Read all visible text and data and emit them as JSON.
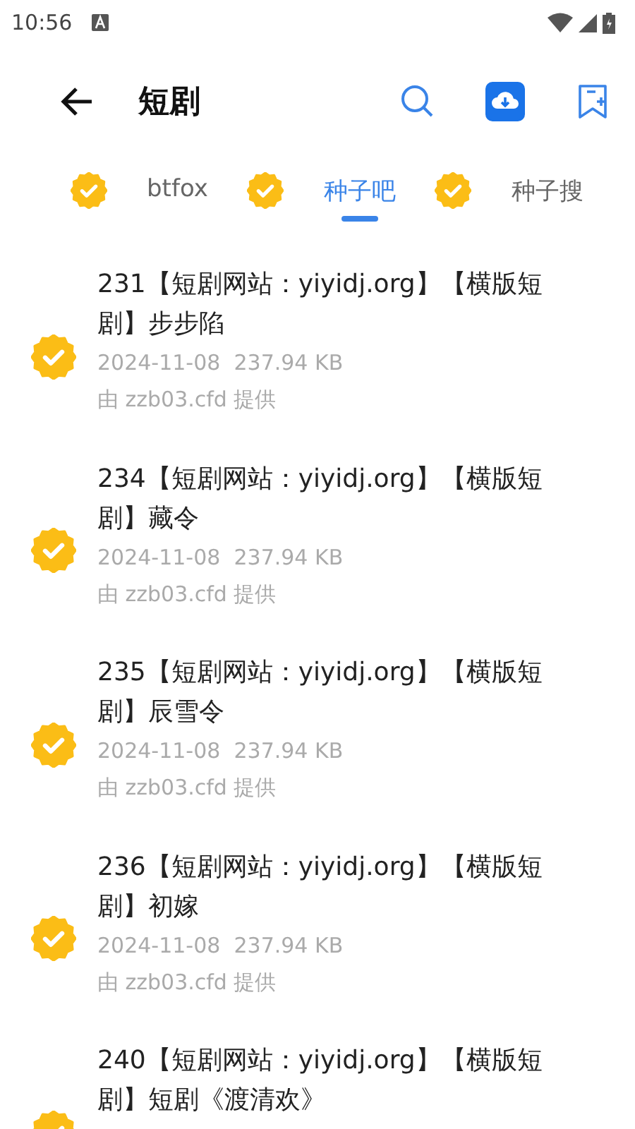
{
  "status_bar": {
    "time": "10:56"
  },
  "app_bar": {
    "title": "短剧"
  },
  "tabs": [
    {
      "label": "btfox",
      "selected": false
    },
    {
      "label": "种子吧",
      "selected": true
    },
    {
      "label": "种子搜",
      "selected": false
    }
  ],
  "items": [
    {
      "title": "231【短剧网站：yiyidj.org】【横版短剧】步步陷",
      "date": "2024-11-08",
      "size": "237.94 KB",
      "source": "由 zzb03.cfd 提供"
    },
    {
      "title": "234【短剧网站：yiyidj.org】【横版短剧】藏令",
      "date": "2024-11-08",
      "size": "237.94 KB",
      "source": "由 zzb03.cfd 提供"
    },
    {
      "title": "235【短剧网站：yiyidj.org】【横版短剧】辰雪令",
      "date": "2024-11-08",
      "size": "237.94 KB",
      "source": "由 zzb03.cfd 提供"
    },
    {
      "title": "236【短剧网站：yiyidj.org】【横版短剧】初嫁",
      "date": "2024-11-08",
      "size": "237.94 KB",
      "source": "由 zzb03.cfd 提供"
    },
    {
      "title": "240【短剧网站：yiyidj.org】【横版短剧】短剧《渡清欢》"
    }
  ]
}
